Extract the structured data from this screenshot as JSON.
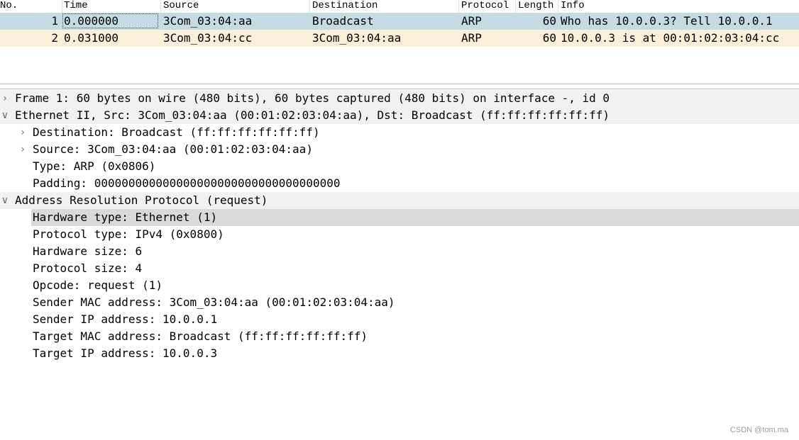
{
  "packet_list": {
    "columns": [
      "No.",
      "Time",
      "Source",
      "Destination",
      "Protocol",
      "Length",
      "Info"
    ],
    "rows": [
      {
        "no": "1",
        "time": "0.000000",
        "source": "3Com_03:04:aa",
        "destination": "Broadcast",
        "protocol": "ARP",
        "length": "60",
        "info": "Who has 10.0.0.3? Tell 10.0.0.1"
      },
      {
        "no": "2",
        "time": "0.031000",
        "source": "3Com_03:04:cc",
        "destination": "3Com_03:04:aa",
        "protocol": "ARP",
        "length": "60",
        "info": "10.0.0.3 is at 00:01:02:03:04:cc"
      }
    ]
  },
  "details": {
    "frame": "Frame 1: 60 bytes on wire (480 bits), 60 bytes captured (480 bits) on interface -, id 0",
    "ethernet": {
      "label": "Ethernet II, Src: 3Com_03:04:aa (00:01:02:03:04:aa), Dst: Broadcast (ff:ff:ff:ff:ff:ff)",
      "destination": "Destination: Broadcast (ff:ff:ff:ff:ff:ff)",
      "source": "Source: 3Com_03:04:aa (00:01:02:03:04:aa)",
      "type": "Type: ARP (0x0806)",
      "padding": "Padding: 000000000000000000000000000000000000"
    },
    "arp": {
      "label": "Address Resolution Protocol (request)",
      "hardware_type": "Hardware type: Ethernet (1)",
      "protocol_type": "Protocol type: IPv4 (0x0800)",
      "hardware_size": "Hardware size: 6",
      "protocol_size": "Protocol size: 4",
      "opcode": "Opcode: request (1)",
      "sender_mac": "Sender MAC address: 3Com_03:04:aa (00:01:02:03:04:aa)",
      "sender_ip": "Sender IP address: 10.0.0.1",
      "target_mac": "Target MAC address: Broadcast (ff:ff:ff:ff:ff:ff)",
      "target_ip": "Target IP address: 10.0.0.3"
    }
  },
  "icons": {
    "collapsed": "chevron-right-icon",
    "expanded": "chevron-down-icon"
  },
  "colors": {
    "row_arp_selected": "#c4dbe3",
    "row_arp": "#fbefd9",
    "selected_field": "#d9d9d9"
  },
  "watermark": "CSDN @tom.ma"
}
